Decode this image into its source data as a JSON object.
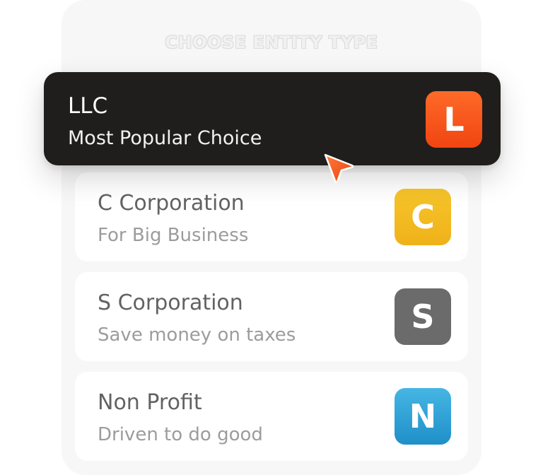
{
  "header": {
    "title": "CHOOSE ENTITY TYPE"
  },
  "options": [
    {
      "title": "LLC",
      "subtitle": "Most Popular Choice",
      "badge_letter": "L",
      "badge_color": "#f2521c",
      "selected": true
    },
    {
      "title": "C Corporation",
      "subtitle": "For Big Business",
      "badge_letter": "C",
      "badge_color": "#f2b71a",
      "selected": false
    },
    {
      "title": "S Corporation",
      "subtitle": "Save money on taxes",
      "badge_letter": "S",
      "badge_color": "#6b6b6b",
      "selected": false
    },
    {
      "title": "Non Profit",
      "subtitle": "Driven to do good",
      "badge_letter": "N",
      "badge_color": "#2ea0d5",
      "selected": false
    }
  ],
  "icons": {
    "cursor": "pointer-arrow-icon"
  }
}
